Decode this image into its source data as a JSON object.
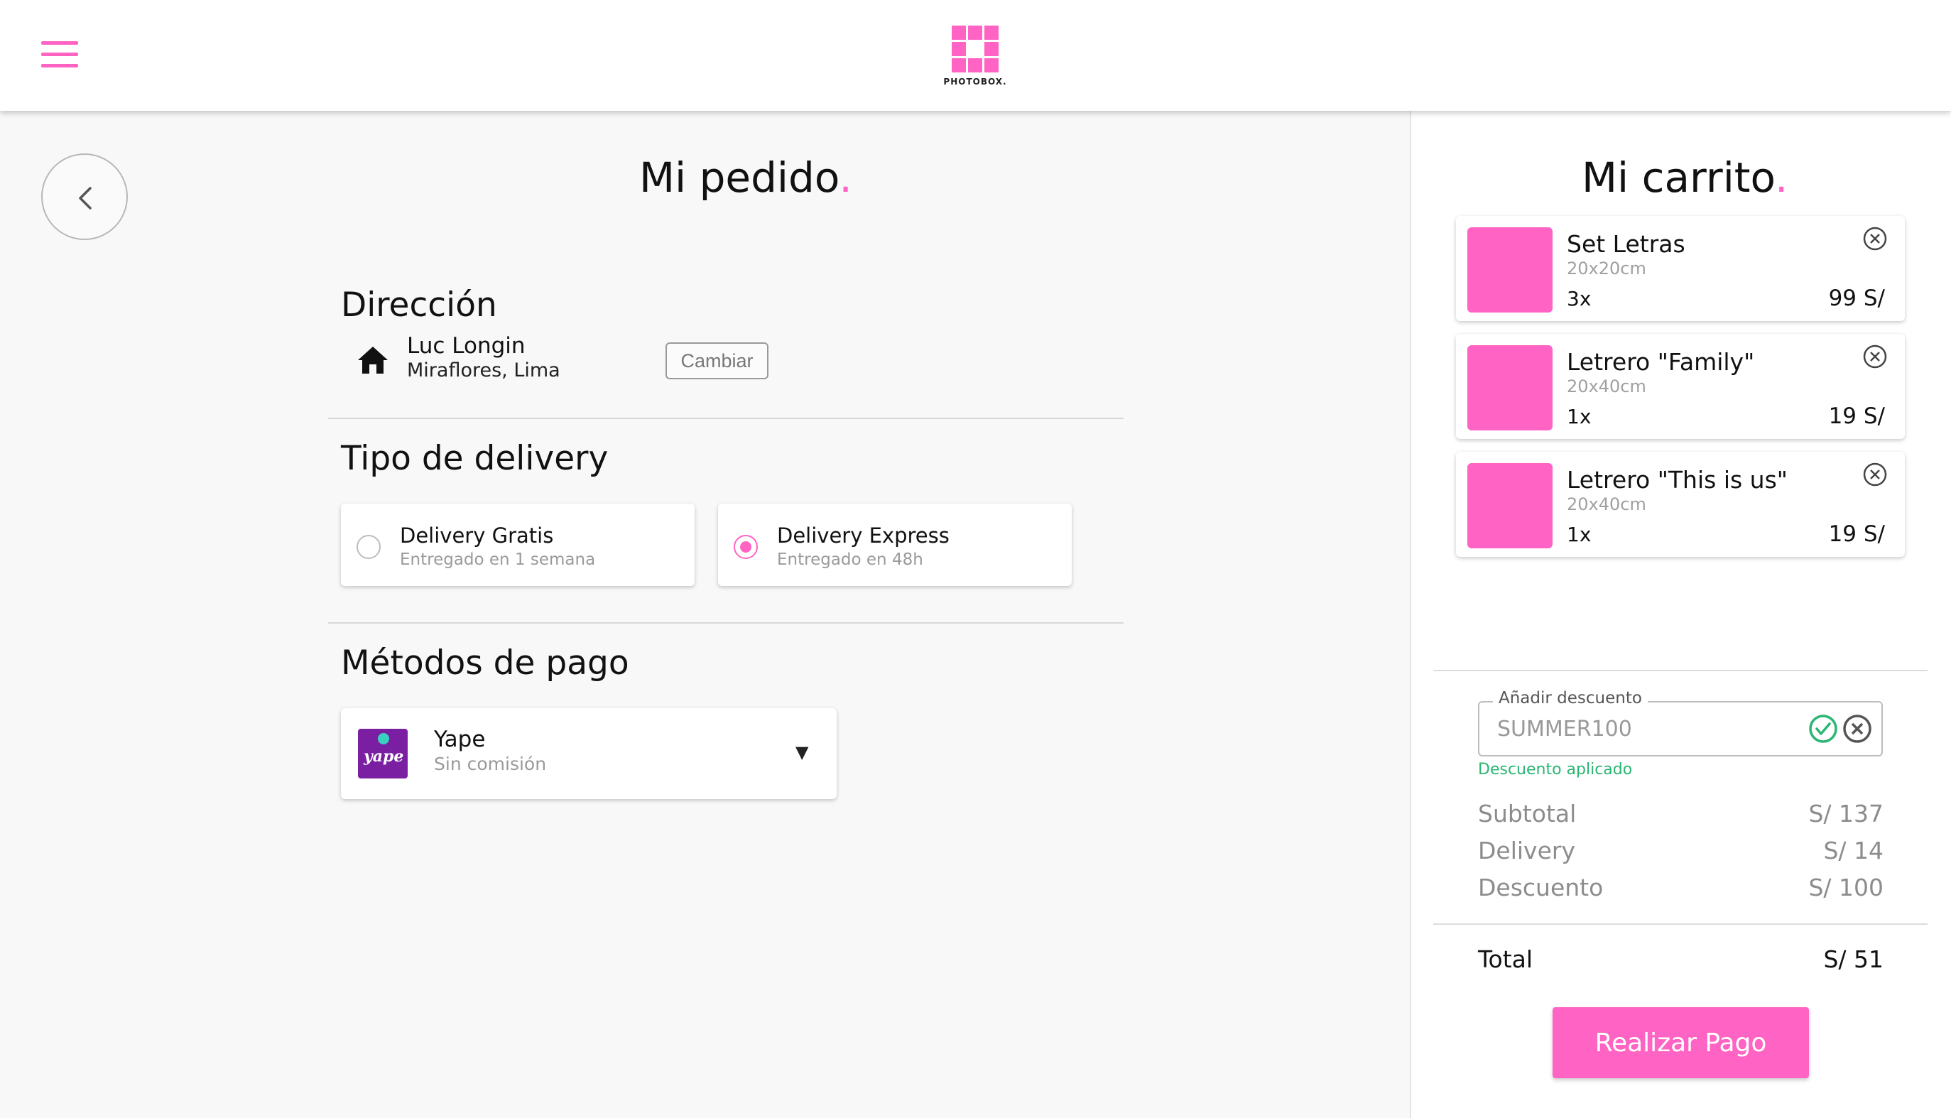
{
  "header": {
    "menu_icon": "hamburger-menu-icon",
    "logo_text": "PHOTOBOX."
  },
  "colors": {
    "accent": "#ff63c3",
    "success": "#2bb673",
    "yape": "#7b1fa2"
  },
  "order": {
    "title": "Mi pedido",
    "title_dot": ".",
    "address": {
      "heading": "Dirección",
      "icon": "home-icon",
      "name": "Luc Longin",
      "city": "Miraflores, Lima",
      "change_label": "Cambiar"
    },
    "delivery": {
      "heading": "Tipo de delivery",
      "options": [
        {
          "title": "Delivery Gratis",
          "subtitle": "Entregado en 1 semana",
          "selected": false
        },
        {
          "title": "Delivery Express",
          "subtitle": "Entregado en 48h",
          "selected": true
        }
      ]
    },
    "payment": {
      "heading": "Métodos de pago",
      "method": {
        "logo_text": "yape",
        "title": "Yape",
        "subtitle": "Sin comisión",
        "caret": "▼"
      }
    }
  },
  "cart": {
    "title": "Mi carrito",
    "title_dot": ".",
    "items": [
      {
        "name": "Set Letras",
        "size": "20x20cm",
        "qty": "3x",
        "price": "99 S/"
      },
      {
        "name": "Letrero \"Family\"",
        "size": "20x40cm",
        "qty": "1x",
        "price": "19 S/"
      },
      {
        "name": "Letrero \"This is us\"",
        "size": "20x40cm",
        "qty": "1x",
        "price": "19 S/"
      }
    ],
    "discount": {
      "label": "Añadir descuento",
      "value": "SUMMER100",
      "status": "Descuento aplicado"
    },
    "summary": {
      "subtotal_label": "Subtotal",
      "subtotal_value": "S/ 137",
      "delivery_label": "Delivery",
      "delivery_value": "S/ 14",
      "discount_label": "Descuento",
      "discount_value": "S/ 100",
      "total_label": "Total",
      "total_value": "S/ 51"
    },
    "pay_button": "Realizar Pago"
  }
}
